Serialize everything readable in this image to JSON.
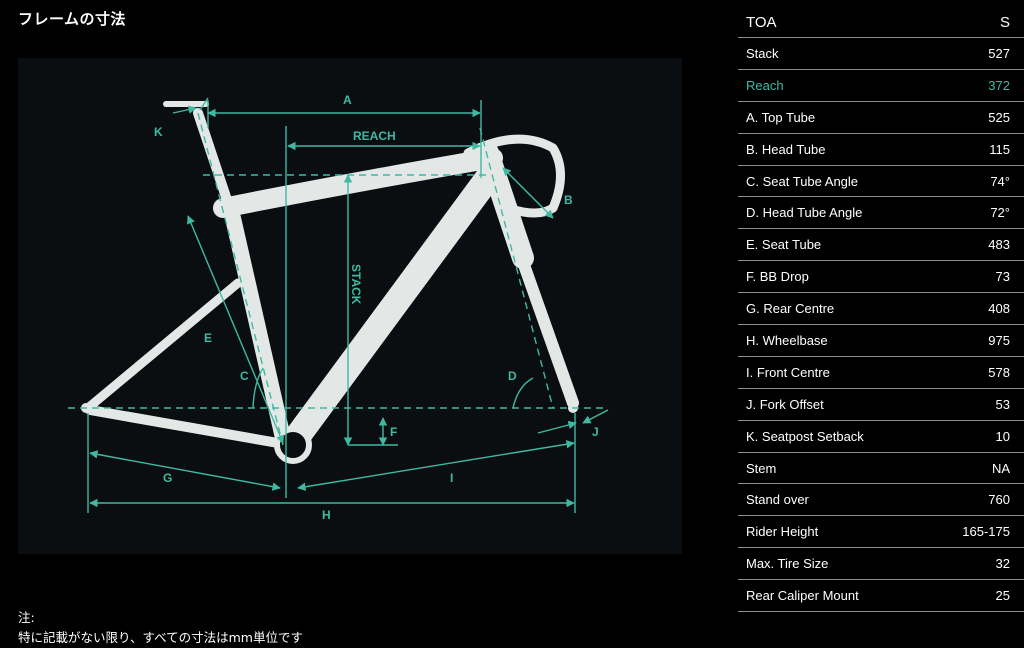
{
  "page": {
    "title": "フレームの寸法",
    "note_line1": "注:",
    "note_line2": "特に記載がない限り、すべての寸法はmm単位です"
  },
  "colors": {
    "accent": "#3fb9a3",
    "background": "#000000",
    "panel": "#0b0e10",
    "frame": "#e8eceb"
  },
  "diagram": {
    "labels": {
      "a": "A",
      "reach": "REACH",
      "b": "B",
      "stack": "STACK",
      "c": "C",
      "d": "D",
      "e": "E",
      "f": "F",
      "g": "G",
      "h": "H",
      "i": "I",
      "j": "J",
      "k": "K"
    }
  },
  "geometry_table": {
    "header": {
      "name": "TOA",
      "size": "S"
    },
    "rows": [
      {
        "name": "Stack",
        "value": "527"
      },
      {
        "name": "Reach",
        "value": "372",
        "highlight": true
      },
      {
        "name": "A. Top Tube",
        "value": "525"
      },
      {
        "name": "B. Head Tube",
        "value": "115"
      },
      {
        "name": "C. Seat Tube Angle",
        "value": "74°"
      },
      {
        "name": "D. Head Tube Angle",
        "value": "72°"
      },
      {
        "name": "E. Seat Tube",
        "value": "483"
      },
      {
        "name": "F. BB Drop",
        "value": "73"
      },
      {
        "name": "G. Rear Centre",
        "value": "408"
      },
      {
        "name": "H. Wheelbase",
        "value": "975"
      },
      {
        "name": "I. Front Centre",
        "value": "578"
      },
      {
        "name": "J. Fork Offset",
        "value": "53"
      },
      {
        "name": "K. Seatpost Setback",
        "value": "10"
      },
      {
        "name": "Stem",
        "value": "NA"
      },
      {
        "name": "Stand over",
        "value": "760"
      },
      {
        "name": "Rider Height",
        "value": "165-175"
      },
      {
        "name": "Max. Tire Size",
        "value": "32"
      },
      {
        "name": "Rear Caliper Mount",
        "value": "25"
      }
    ]
  }
}
